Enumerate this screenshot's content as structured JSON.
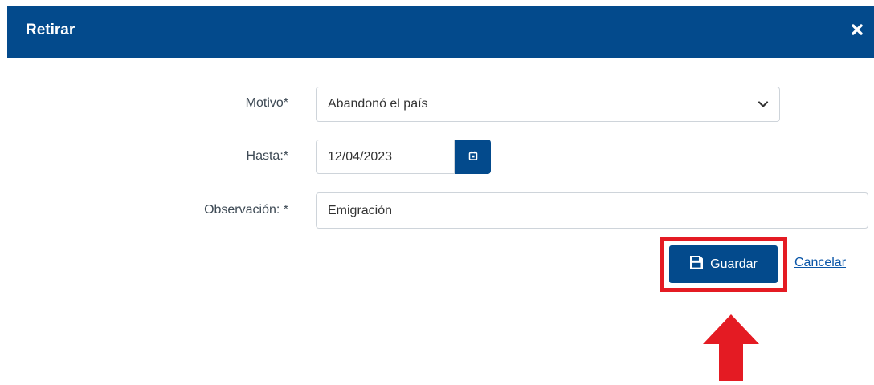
{
  "dialog": {
    "title": "Retirar",
    "close_icon": "close-icon"
  },
  "form": {
    "motivo": {
      "label": "Motivo*",
      "value": "Abandonó el país"
    },
    "hasta": {
      "label": "Hasta:*",
      "value": "12/04/2023",
      "button_icon": "calendar-icon"
    },
    "observacion": {
      "label": "Observación: *",
      "value": "Emigración"
    }
  },
  "actions": {
    "save_label": "Guardar",
    "save_icon": "save-icon",
    "cancel_label": "Cancelar"
  },
  "annotations": {
    "highlight_color": "#e41b23",
    "arrow_icon": "up-arrow-icon"
  },
  "colors": {
    "brand": "#034a8c",
    "link": "#0a56a8"
  }
}
